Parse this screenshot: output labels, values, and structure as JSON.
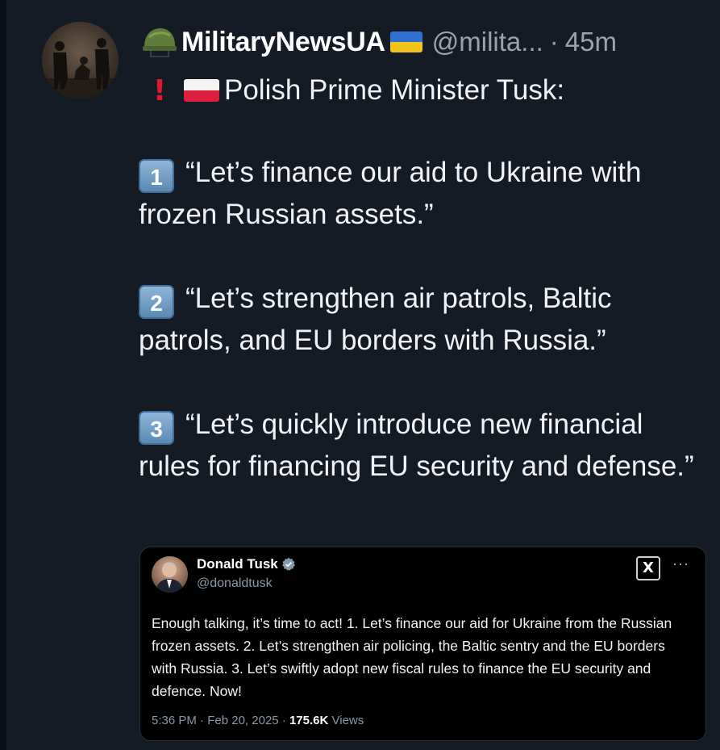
{
  "post": {
    "author_name": "MilitaryNewsUA",
    "handle": "@milita...",
    "separator": "·",
    "time": "45m",
    "icons": [
      "military-helmet-icon",
      "ukraine-flag-icon",
      "red-exclamation-icon",
      "poland-flag-icon"
    ],
    "headline": "Polish Prime Minister Tusk:",
    "points": [
      {
        "number": "1",
        "text": "“Let’s finance our aid to Ukraine with frozen Russian assets.”"
      },
      {
        "number": "2",
        "text": "“Let’s strengthen air patrols, Baltic patrols, and EU borders with Russia.”"
      },
      {
        "number": "3",
        "text": "“Let’s quickly introduce new financial rules for financing EU security and defense.”"
      }
    ]
  },
  "quoted": {
    "name": "Donald Tusk",
    "handle": "@donaldtusk",
    "body": "Enough talking, it’s time to act! 1. Let’s finance our aid for Ukraine from the Russian frozen assets. 2. Let’s strengthen air policing, the Baltic sentry and the EU borders with Russia. 3. Let’s swiftly adopt new fiscal rules to finance the EU security and defence. Now!",
    "time": "5:36 PM",
    "date": "Feb 20, 2025",
    "views_count": "175.6K",
    "views_label": "Views",
    "more_label": "···",
    "x_logo": "X"
  },
  "colors": {
    "background": "#151b25",
    "card_background": "#000000",
    "muted": "#9aa3ad",
    "verified": "#829aab",
    "exclamation": "#e0182f"
  }
}
